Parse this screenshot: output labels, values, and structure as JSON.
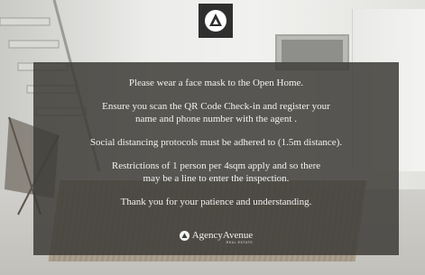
{
  "logo": {
    "icon": "agency-triangle-logo-icon"
  },
  "notice": {
    "paragraphs": [
      {
        "lines": [
          "Please wear a face mask to the Open Home."
        ]
      },
      {
        "lines": [
          "Ensure you scan the QR Code Check-in and register your",
          "name and phone number with the agent ."
        ]
      },
      {
        "lines": [
          "Social distancing protocols must be adhered to (1.5m distance)."
        ]
      },
      {
        "lines": [
          "Restrictions of 1 person per 4sqm apply and so there",
          "may be a  line to enter the inspection."
        ]
      },
      {
        "lines": [
          "Thank you for your patience and understanding."
        ]
      }
    ]
  },
  "brand": {
    "name": "AgencyAvenue",
    "tagline": "REAL ESTATE",
    "icon": "agency-triangle-logo-icon"
  },
  "colors": {
    "panel": "#3e3c38",
    "text": "#f2f2f0",
    "logo_tile": "#2f2f2f"
  }
}
